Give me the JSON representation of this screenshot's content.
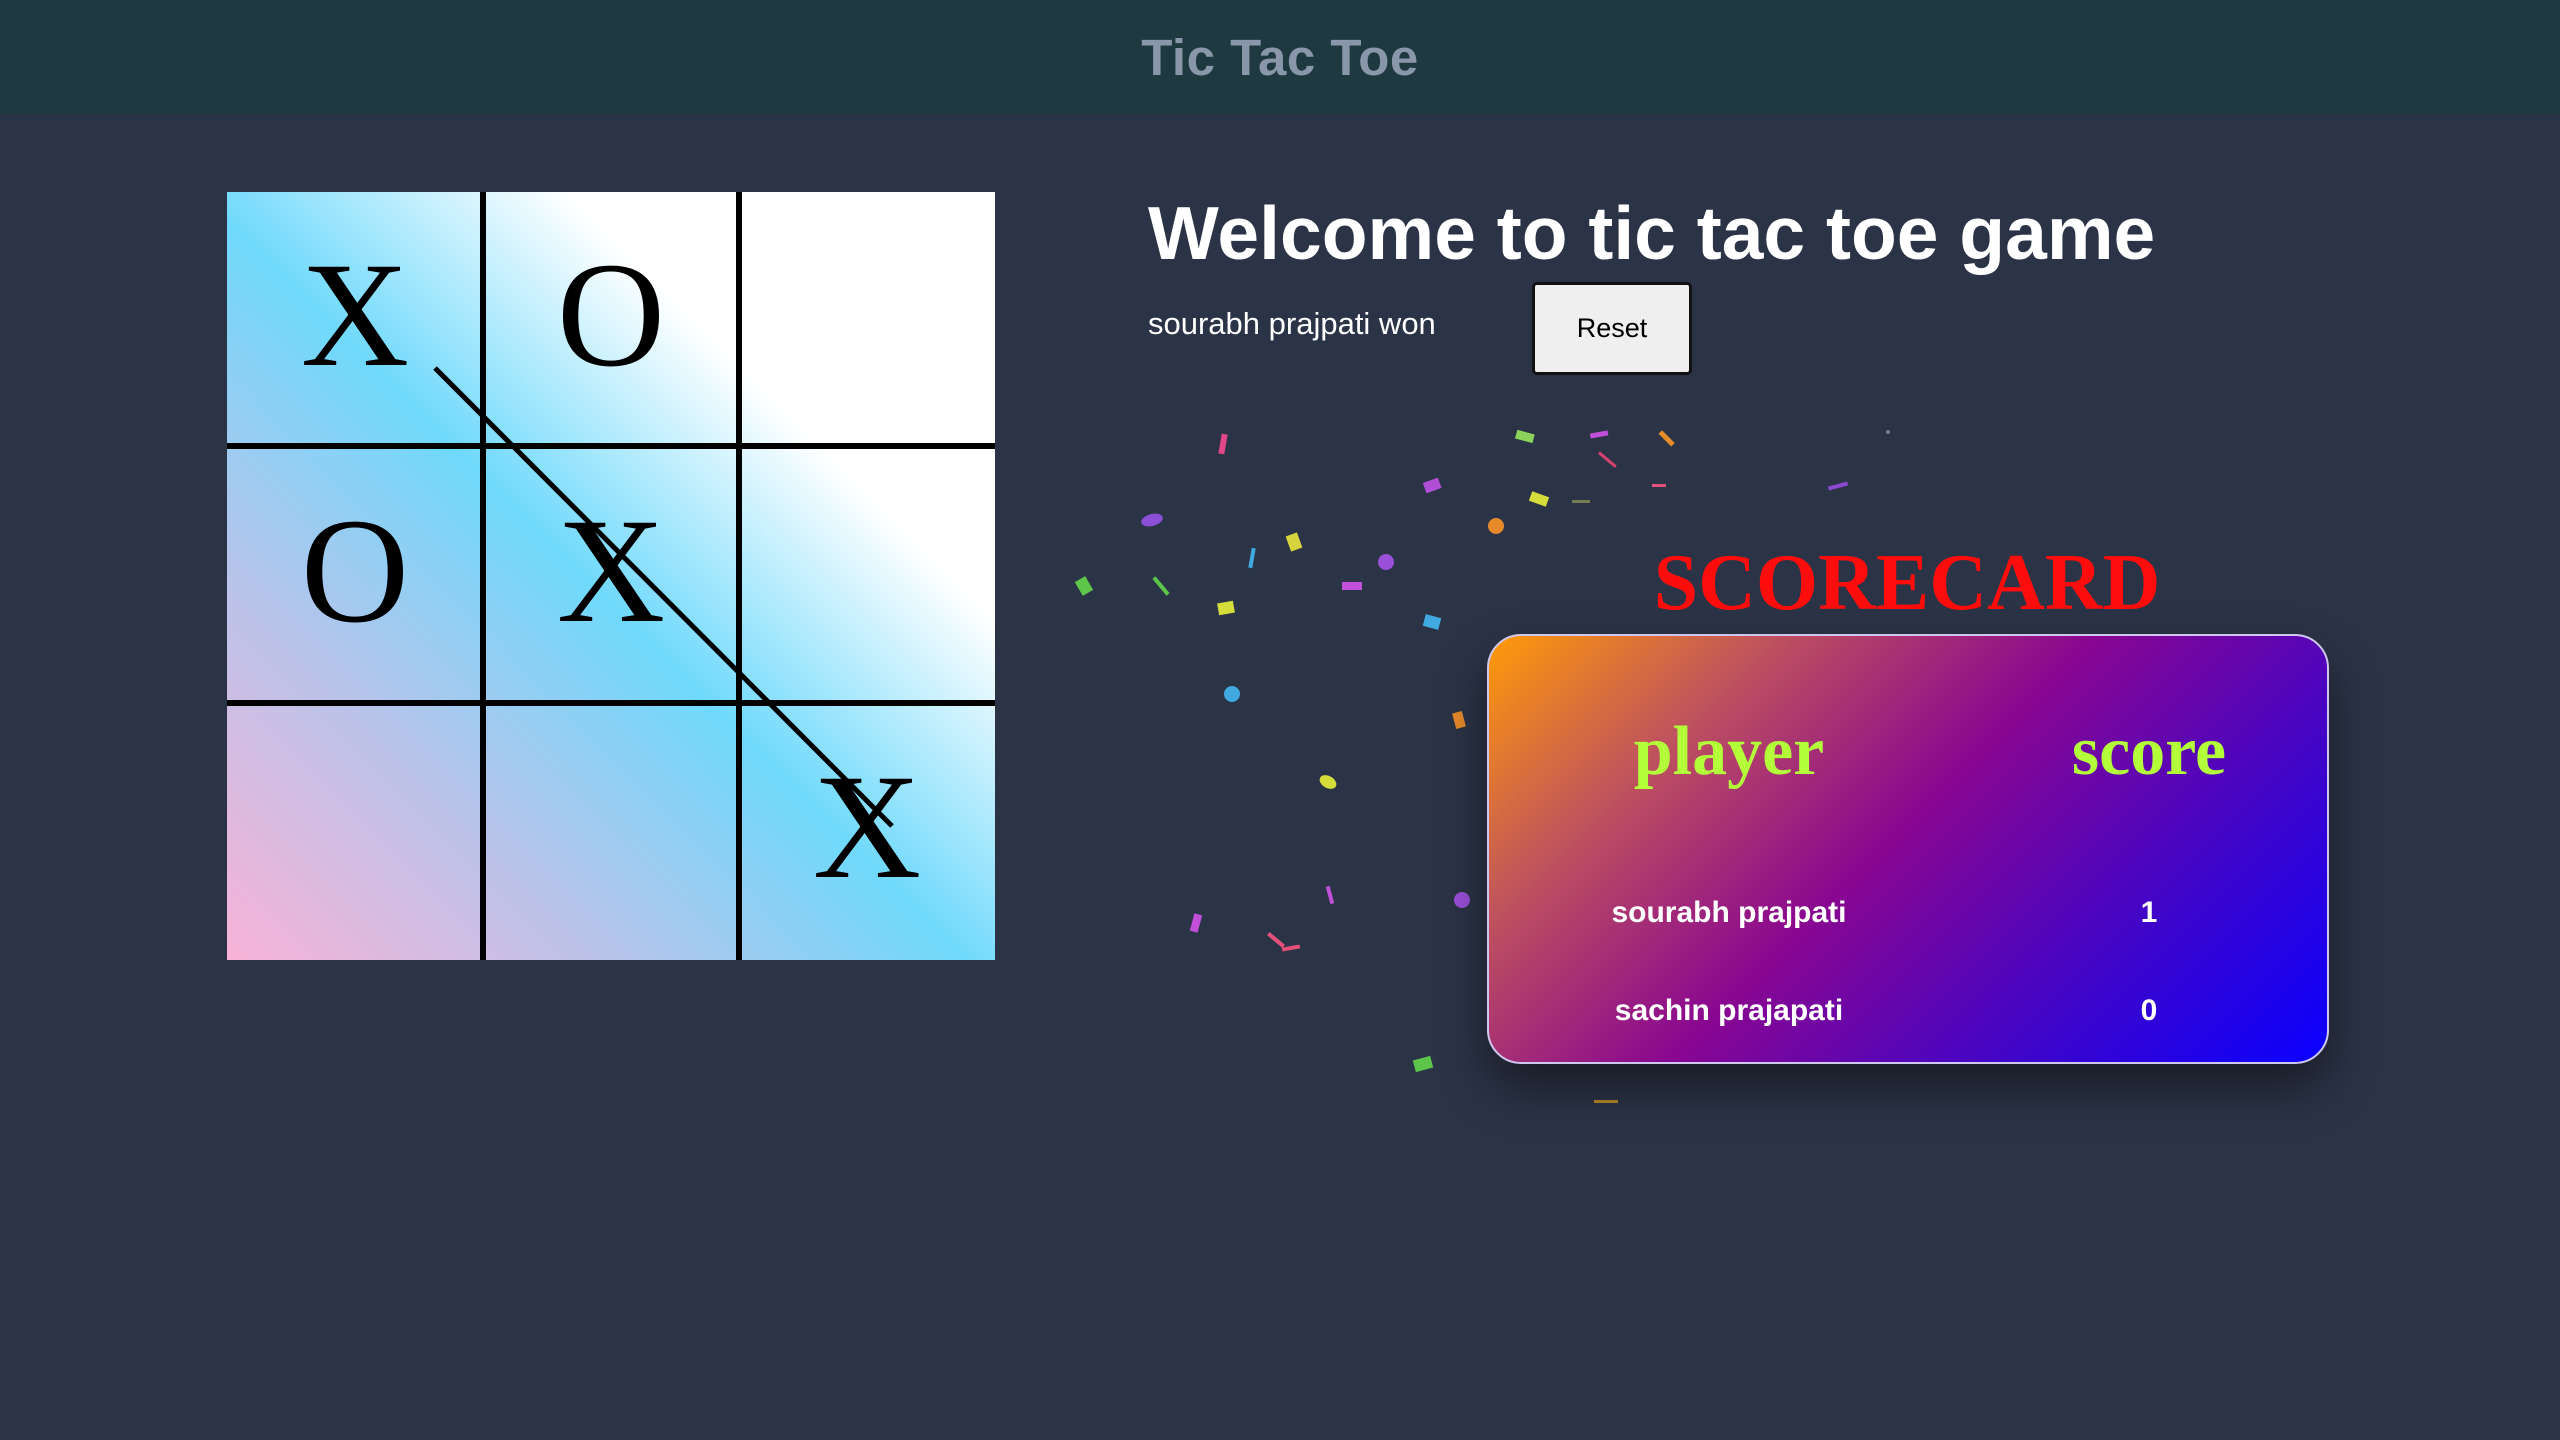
{
  "app": {
    "title": "Tic Tac Toe"
  },
  "game": {
    "board": [
      "X",
      "O",
      "",
      "O",
      "X",
      "",
      "",
      "",
      "X"
    ],
    "winning_line": [
      0,
      4,
      8
    ]
  },
  "main": {
    "heading": "Welcome to tic tac toe game",
    "status": "sourabh prajpati won",
    "reset_label": "Reset"
  },
  "scorecard": {
    "heading": "SCORECARD",
    "columns": [
      "player",
      "score"
    ],
    "rows": [
      {
        "player": "sourabh prajpati",
        "score": "1"
      },
      {
        "player": "sachin prajapati",
        "score": "0"
      }
    ]
  },
  "colors": {
    "navbar_bg": "#1e3a40",
    "page_bg": "#2b3346",
    "scorecard_heading": "#ff0d0d",
    "scorecard_column_heading": "#b2ff3a"
  }
}
